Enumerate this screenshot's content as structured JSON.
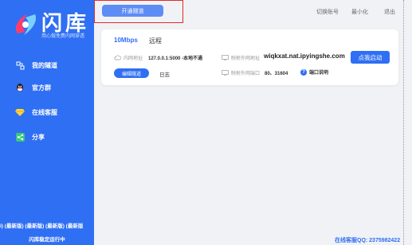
{
  "brand": {
    "name": "闪库",
    "tagline": "用心做免费内网穿透"
  },
  "sidebar": {
    "items": [
      {
        "label": "我的隧道",
        "icon": "tunnel-icon"
      },
      {
        "label": "官方群",
        "icon": "qq-icon"
      },
      {
        "label": "在线客服",
        "icon": "diamond-icon"
      },
      {
        "label": "分享",
        "icon": "share-icon"
      }
    ],
    "version_text": "i) (最新版) (最新版) (最新版) (最新版",
    "status_text": "闪库稳定运行中"
  },
  "topbar": {
    "open_tunnel": "开通隧道",
    "switch_account": "切换账号",
    "minimize": "最小化",
    "exit": "退出"
  },
  "tunnel": {
    "bandwidth": "10Mbps",
    "remark": "远程",
    "local_label": "内网地址",
    "local_value": "127.0.0.1:5000 -本地不通",
    "external_label": "映射外网地址",
    "external_value": "wiqkxat.nat.ipyingshe.com",
    "port_label": "映射外网端口",
    "port_value": "80、31604",
    "start_label": "点我启动",
    "edit_label": "编辑隧道",
    "log_label": "日志",
    "help_label": "端口说明"
  },
  "support": "在线客服QQ: 2375982422",
  "colors": {
    "accent": "#2f6ff3",
    "highlight_box": "#e12b2b"
  }
}
